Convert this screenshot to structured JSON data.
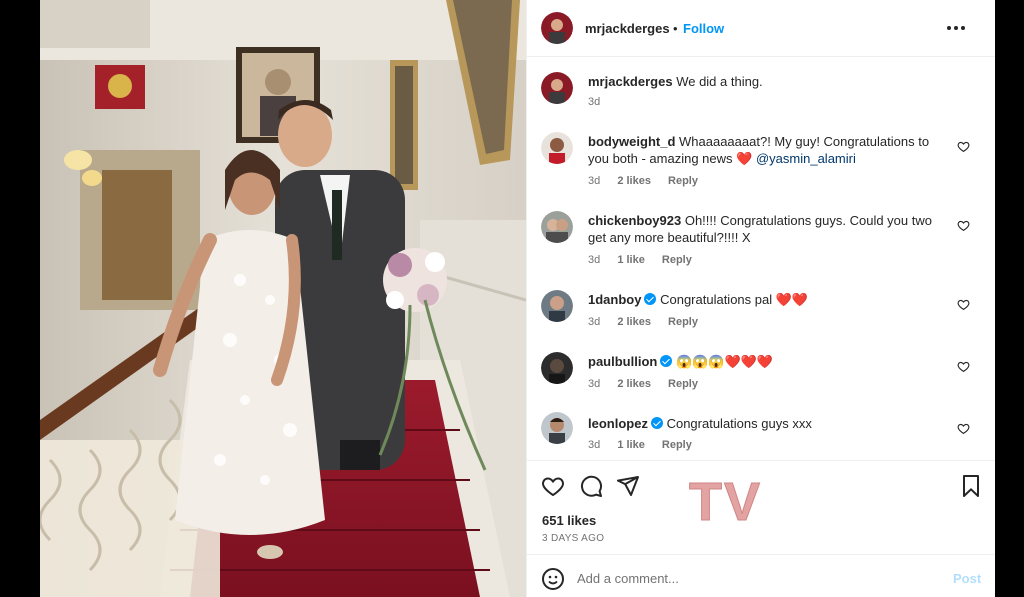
{
  "post": {
    "author": "mrjackderges",
    "follow_label": "Follow",
    "separator": "•",
    "caption": {
      "username": "mrjackderges",
      "text": "We did a thing.",
      "time": "3d"
    }
  },
  "comments": [
    {
      "username": "bodyweight_d",
      "text": "Whaaaaaaaat?! My guy! Congratulations to you both - amazing news",
      "emoji": "❤️",
      "mention": "@yasmin_alamiri",
      "time": "3d",
      "likes": "2 likes",
      "reply": "Reply"
    },
    {
      "username": "chickenboy923",
      "text": "Oh!!!! Congratulations guys. Could you two get any more beautiful?!!!! X",
      "time": "3d",
      "likes": "1 like",
      "reply": "Reply"
    },
    {
      "username": "1danboy",
      "text": "Congratulations pal",
      "emoji": "❤️❤️",
      "time": "3d",
      "likes": "2 likes",
      "reply": "Reply"
    },
    {
      "username": "paulbullion",
      "text": "",
      "emoji": "😱😱😱❤️❤️❤️",
      "time": "3d",
      "likes": "2 likes",
      "reply": "Reply"
    },
    {
      "username": "leonlopez",
      "text": "Congratulations guys xxx",
      "time": "3d",
      "likes": "1 like",
      "reply": "Reply"
    }
  ],
  "stats": {
    "likes": "651 likes",
    "posted": "3 DAYS AGO"
  },
  "watermark": "TV",
  "composer": {
    "placeholder": "Add a comment...",
    "post_label": "Post"
  },
  "icons": {
    "like": "heart-icon",
    "comment": "comment-icon",
    "share": "paper-plane-icon",
    "save": "bookmark-icon",
    "emoji": "smiley-icon",
    "more": "more-options-icon"
  },
  "colors": {
    "link": "#0095f6",
    "text": "#262626",
    "muted": "#737373",
    "heart_red": "#ed4956",
    "post_disabled": "#b2dffc",
    "watermark": "#e29a9a"
  }
}
